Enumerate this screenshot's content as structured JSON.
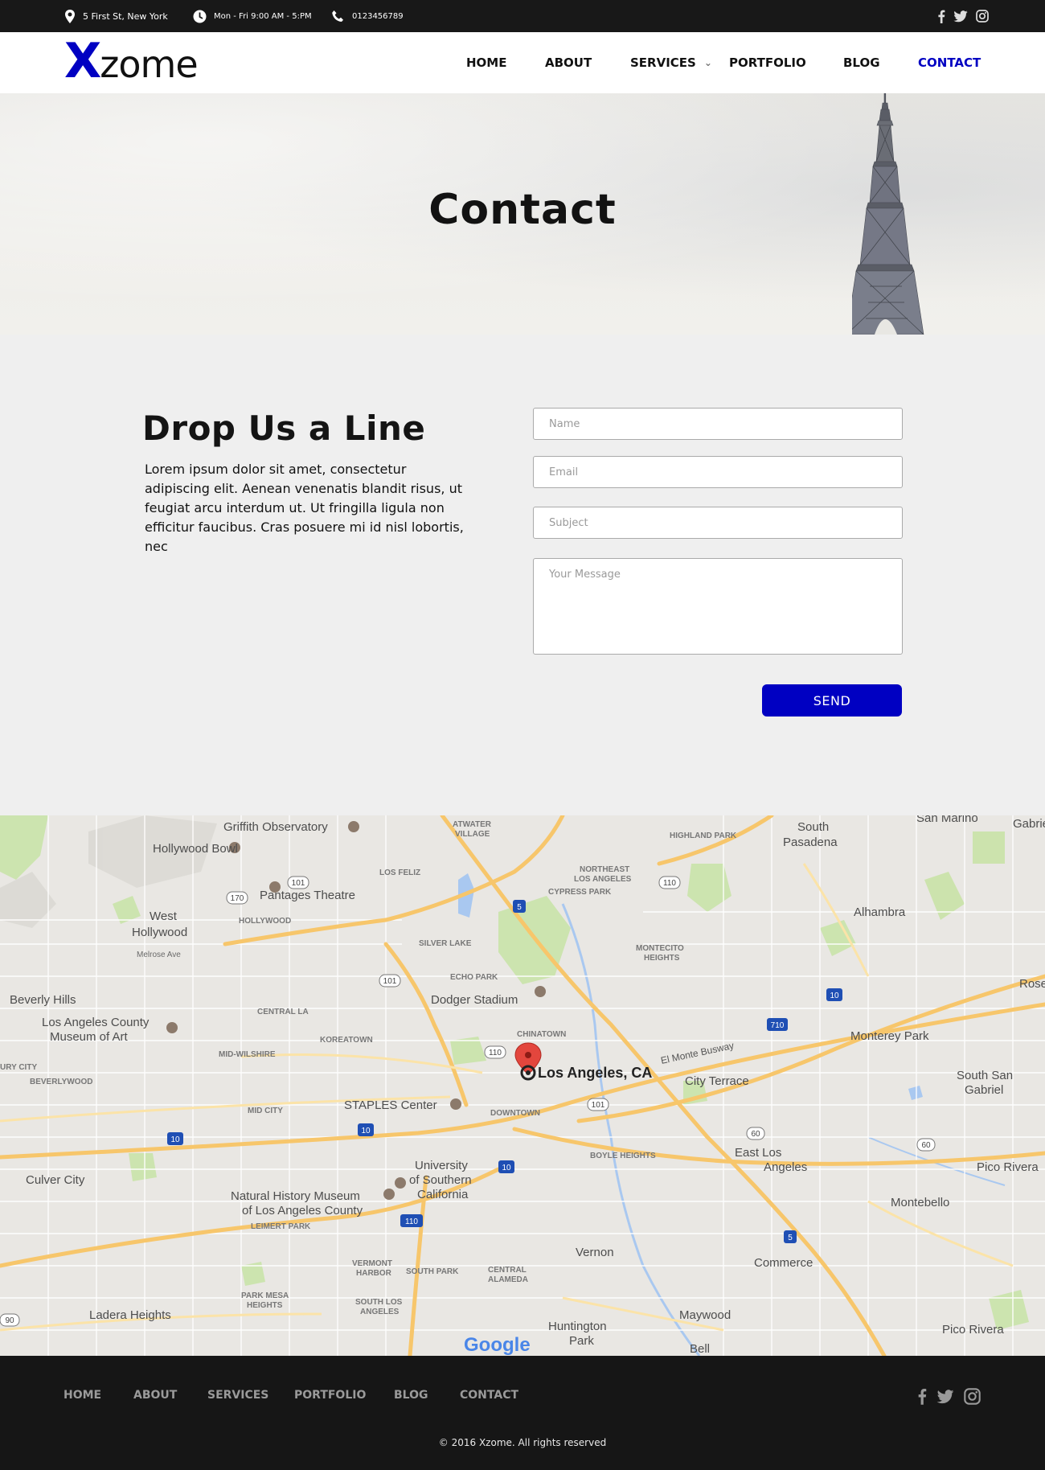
{
  "topbar": {
    "address": "5 First St, New York",
    "hours": "Mon - Fri 9:00 AM - 5:PM",
    "phone": "0123456789",
    "social_icons": [
      "facebook-icon",
      "twitter-icon",
      "instagram-icon"
    ]
  },
  "header": {
    "logo_x": "X",
    "logo_rest": "zome",
    "nav": [
      {
        "label": "HOME"
      },
      {
        "label": "ABOUT"
      },
      {
        "label": "SERVICES",
        "has_dropdown": true
      },
      {
        "label": "PORTFOLIO"
      },
      {
        "label": "BLOG"
      },
      {
        "label": "CONTACT",
        "active": true
      }
    ]
  },
  "hero": {
    "title": "Contact"
  },
  "contact": {
    "heading": "Drop Us a Line",
    "text": "Lorem ipsum dolor sit amet, consectetur adipiscing elit. Aenean venenatis blandit risus, ut feugiat arcu interdum ut. Ut fringilla ligula non efficitur faucibus. Cras posuere mi id nisl lobortis, nec",
    "form": {
      "name_placeholder": "Name",
      "email_placeholder": "Email",
      "subject_placeholder": "Subject",
      "message_placeholder": "Your Message",
      "send_label": "SEND"
    }
  },
  "map": {
    "marker_label": "Los Angeles, CA",
    "attribution": "Google",
    "places": {
      "griffith": "Griffith Observatory",
      "atwater": "ATWATER",
      "village": "VILLAGE",
      "highland": "HIGHLAND PARK",
      "south": "South",
      "pasadena": "Pasadena",
      "sanmarino": "San Marino",
      "gabriel": "Gabrie",
      "hollywoodbowl": "Hollywood Bowl",
      "losfeliz": "LOS FELIZ",
      "northeast": "NORTHEAST",
      "losangeles": "LOS ANGELES",
      "cypress": "CYPRESS PARK",
      "pantages": "Pantages Theatre",
      "hollywood": "HOLLYWOOD",
      "west": "West",
      "westhollywood": "Hollywood",
      "melrose": "Melrose Ave",
      "alhambra": "Alhambra",
      "silverlake": "SILVER LAKE",
      "montecito": "MONTECITO",
      "heights": "HEIGHTS",
      "echopark": "ECHO PARK",
      "dodger": "Dodger Stadium",
      "beverly": "Beverly Hills",
      "lacma1": "Los Angeles County",
      "lacma2": "Museum of Art",
      "centralla": "CENTRAL LA",
      "koreatown": "KOREATOWN",
      "chinatown": "CHINATOWN",
      "montereypark": "Monterey Park",
      "midwilshire": "MID-WILSHIRE",
      "citycity": "URY CITY",
      "beverlywood": "BEVERLYWOOD",
      "cityterrace": "City Terrace",
      "southsan": "South San",
      "gabriel2": "Gabriel",
      "rose": "Rose",
      "staples": "STAPLES Center",
      "midcity": "MID CITY",
      "downtown": "DOWNTOWN",
      "boyle": "BOYLE HEIGHTS",
      "usc1": "University",
      "usc2": "of Southern",
      "usc3": "California",
      "eastla1": "East Los",
      "eastla2": "Angeles",
      "culver": "Culver City",
      "nhm1": "Natural History Museum",
      "nhm2": "of Los Angeles County",
      "leimert": "LEIMERT PARK",
      "montebello": "Montebello",
      "picorivera": "Pico Rivera",
      "vernon": "Vernon",
      "commerce": "Commerce",
      "vermont1": "VERMONT",
      "vermont2": "HARBOR",
      "southpark": "SOUTH PARK",
      "central1": "CENTRAL",
      "central2": "ALAMEDA",
      "parkmesa1": "PARK MESA",
      "parkmesa2": "HEIGHTS",
      "southla1": "SOUTH LOS",
      "southla2": "ANGELES",
      "ladera": "Ladera Heights",
      "maywood": "Maywood",
      "huntington1": "Huntington",
      "huntington2": "Park",
      "bell": "Bell",
      "picorivera2": "Pico Rivera",
      "elmonte": "El Monte Busway"
    }
  },
  "footer": {
    "nav": [
      {
        "label": "HOME"
      },
      {
        "label": "ABOUT"
      },
      {
        "label": "SERVICES"
      },
      {
        "label": "PORTFOLIO"
      },
      {
        "label": "BLOG"
      },
      {
        "label": "CONTACT"
      }
    ],
    "social_icons": [
      "facebook-icon",
      "twitter-icon",
      "instagram-icon"
    ],
    "copyright": "© 2016 Xzome. All rights reserved"
  },
  "colors": {
    "accent": "#0000c2",
    "topbar_bg": "#181818",
    "footer_bg": "#161616",
    "page_bg": "#efefef"
  }
}
